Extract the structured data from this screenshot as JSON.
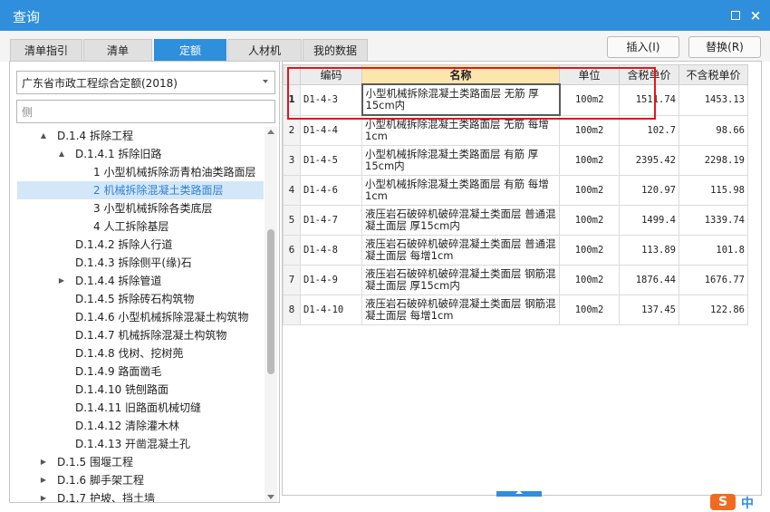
{
  "window": {
    "title": "查询",
    "minimize_icon": "restore-icon",
    "close_label": "×"
  },
  "tabs": [
    {
      "label": "清单指引",
      "active": false
    },
    {
      "label": "清单",
      "active": false
    },
    {
      "label": "定额",
      "active": true
    },
    {
      "label": "人材机",
      "active": false
    },
    {
      "label": "我的数据",
      "active": false
    }
  ],
  "actions": {
    "insert": "插入(I)",
    "replace": "替换(R)"
  },
  "left": {
    "library": "广东省市政工程综合定额(2018)",
    "filter_value": "",
    "filter_placeholder": "侧",
    "tree": [
      {
        "label": "D.1.4 拆除工程",
        "toggle": "▲"
      },
      {
        "label": "D.1.4.1 拆除旧路",
        "toggle": "▲"
      },
      {
        "label": "1 小型机械拆除沥青柏油类路面层",
        "toggle": ""
      },
      {
        "label": "2 机械拆除混凝土类路面层",
        "toggle": "",
        "selected": true
      },
      {
        "label": "3 小型机械拆除各类底层",
        "toggle": ""
      },
      {
        "label": "4 人工拆除基层",
        "toggle": ""
      },
      {
        "label": "D.1.4.2 拆除人行道",
        "toggle": ""
      },
      {
        "label": "D.1.4.3 拆除侧平(缘)石",
        "toggle": ""
      },
      {
        "label": "D.1.4.4 拆除管道",
        "toggle": "▶"
      },
      {
        "label": "D.1.4.5 拆除砖石构筑物",
        "toggle": ""
      },
      {
        "label": "D.1.4.6 小型机械拆除混凝土构筑物",
        "toggle": ""
      },
      {
        "label": "D.1.4.7 机械拆除混凝土构筑物",
        "toggle": ""
      },
      {
        "label": "D.1.4.8 伐树、挖树蔸",
        "toggle": ""
      },
      {
        "label": "D.1.4.9 路面凿毛",
        "toggle": ""
      },
      {
        "label": "D.1.4.10 铣刨路面",
        "toggle": ""
      },
      {
        "label": "D.1.4.11 旧路面机械切缝",
        "toggle": ""
      },
      {
        "label": "D.1.4.12 清除灌木林",
        "toggle": ""
      },
      {
        "label": "D.1.4.13 开凿混凝土孔",
        "toggle": ""
      },
      {
        "label": "D.1.5 围堰工程",
        "toggle": "▶"
      },
      {
        "label": "D.1.6 脚手架工程",
        "toggle": "▶"
      },
      {
        "label": "D.1.7 护坡、挡土墙",
        "toggle": "▶"
      }
    ]
  },
  "grid": {
    "headers": {
      "idx": "",
      "code": "编码",
      "name": "名称",
      "unit": "单位",
      "tax_price": "含税单价",
      "notax_price": "不含税单价"
    },
    "rows": [
      {
        "idx": "1",
        "code": "D1-4-3",
        "name": "小型机械拆除混凝土类路面层 无筋 厚15cm内",
        "unit": "100m2",
        "tax_price": "1511.74",
        "notax_price": "1453.13"
      },
      {
        "idx": "2",
        "code": "D1-4-4",
        "name": "小型机械拆除混凝土类路面层 无筋 每增1cm",
        "unit": "100m2",
        "tax_price": "102.7",
        "notax_price": "98.66"
      },
      {
        "idx": "3",
        "code": "D1-4-5",
        "name": "小型机械拆除混凝土类路面层 有筋 厚15cm内",
        "unit": "100m2",
        "tax_price": "2395.42",
        "notax_price": "2298.19"
      },
      {
        "idx": "4",
        "code": "D1-4-6",
        "name": "小型机械拆除混凝土类路面层 有筋 每增1cm",
        "unit": "100m2",
        "tax_price": "120.97",
        "notax_price": "115.98"
      },
      {
        "idx": "5",
        "code": "D1-4-7",
        "name": "液压岩石破碎机破碎混凝土类面层 普通混凝土面层 厚15cm内",
        "unit": "100m2",
        "tax_price": "1499.4",
        "notax_price": "1339.74"
      },
      {
        "idx": "6",
        "code": "D1-4-8",
        "name": "液压岩石破碎机破碎混凝土类面层 普通混凝土面层 每增1cm",
        "unit": "100m2",
        "tax_price": "113.89",
        "notax_price": "101.8"
      },
      {
        "idx": "7",
        "code": "D1-4-9",
        "name": "液压岩石破碎机破碎混凝土类面层 钢筋混凝土面层 厚15cm内",
        "unit": "100m2",
        "tax_price": "1876.44",
        "notax_price": "1676.77"
      },
      {
        "idx": "8",
        "code": "D1-4-10",
        "name": "液压岩石破碎机破碎混凝土类面层 钢筋混凝土面层 每增1cm",
        "unit": "100m2",
        "tax_price": "137.45",
        "notax_price": "122.86"
      }
    ]
  },
  "logo": {
    "mark": "S",
    "text": "中"
  },
  "colors": {
    "accent": "#2f8fdc",
    "highlight_box": "#e2171c",
    "selected_node_bg": "#d3e7f9",
    "name_header_bg": "#fde6ae"
  }
}
